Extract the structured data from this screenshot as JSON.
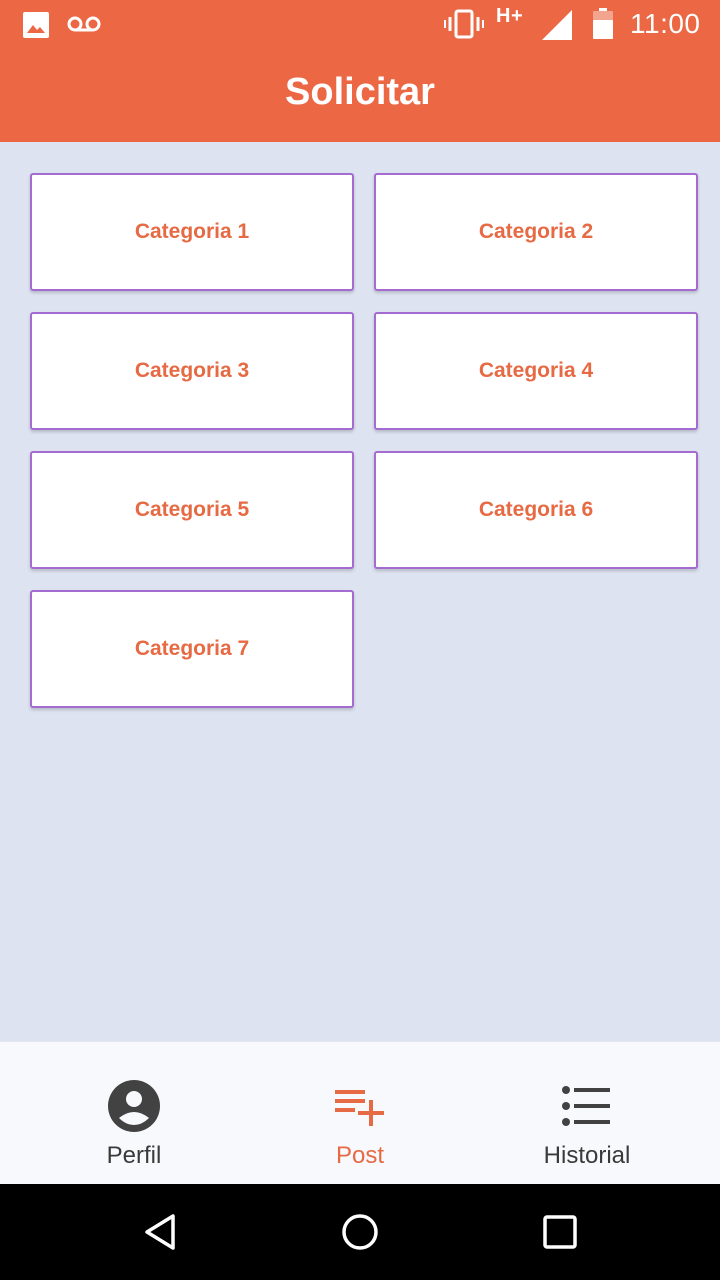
{
  "status_bar": {
    "network": "H+",
    "time": "11:00",
    "icons": [
      "image-icon",
      "voicemail-icon",
      "vibrate-icon",
      "signal-icon",
      "battery-icon"
    ]
  },
  "header": {
    "title": "Solicitar",
    "color": "#ec6743"
  },
  "categories": [
    "Categoria 1",
    "Categoria 2",
    "Categoria 3",
    "Categoria 4",
    "Categoria 5",
    "Categoria 6",
    "Categoria 7"
  ],
  "bottom_nav": {
    "active": "Post",
    "active_color": "#e66a43",
    "items": [
      {
        "label": "Perfil",
        "icon": "account-circle-icon"
      },
      {
        "label": "Post",
        "icon": "playlist-add-icon"
      },
      {
        "label": "Historial",
        "icon": "list-icon"
      }
    ]
  },
  "system_nav": {
    "icons": [
      "back-icon",
      "home-icon",
      "recent-apps-icon"
    ]
  },
  "colors": {
    "background": "#dde3f0",
    "card_border": "#a46bd0",
    "accent": "#e66a43"
  }
}
